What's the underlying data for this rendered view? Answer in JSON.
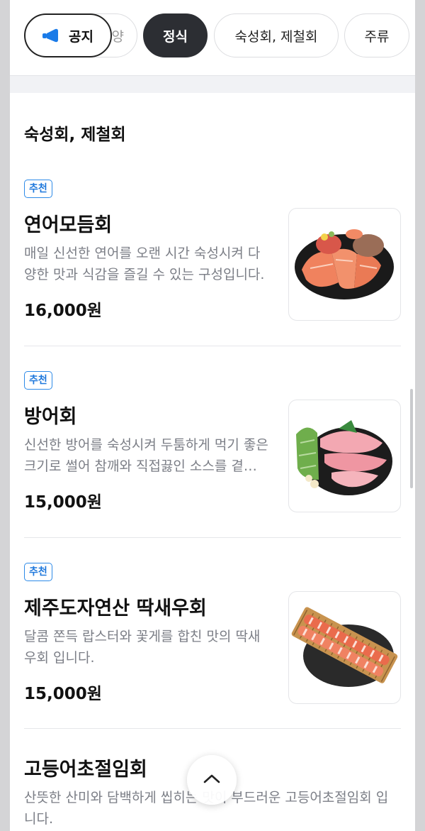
{
  "tabs": {
    "notice_label": "공지",
    "items": [
      {
        "label": "정식",
        "active": true
      },
      {
        "label": "숙성회, 제철회",
        "active": false
      },
      {
        "label": "주류",
        "active": false
      }
    ]
  },
  "section": {
    "title": "숙성회, 제철회"
  },
  "menu_items": [
    {
      "badge": "추천",
      "name": "연어모듬회",
      "description": "매일 신선한 연어를 오랜 시간 숙성시켜 다양한 맛과 식감을 즐길 수 있는 구성입니다.",
      "price": "16,000원",
      "image_icon": "salmon-platter-icon"
    },
    {
      "badge": "추천",
      "name": "방어회",
      "description": "신선한 방어를 숙성시켜 두툼하게 먹기 좋은 크기로 썰어 참깨와 직접끓인 소스를 곁들였습니다.",
      "price": "15,000원",
      "image_icon": "yellowtail-platter-icon"
    },
    {
      "badge": "추천",
      "name": "제주도자연산 딱새우회",
      "description": "달콤 쫀득 랍스터와 꽃게를 합친 맛의 딱새우회 입니다.",
      "price": "15,000원",
      "image_icon": "shrimp-platter-icon"
    },
    {
      "name": "고등어초절임회",
      "description": "산뜻한 산미와 담백하게 씹히는 맛이 부드러운 고등어초절임회 입니다."
    }
  ],
  "colors": {
    "accent_badge": "#1e78dc",
    "active_tab": "#2c2e33",
    "notice_icon": "#1a7be8"
  }
}
